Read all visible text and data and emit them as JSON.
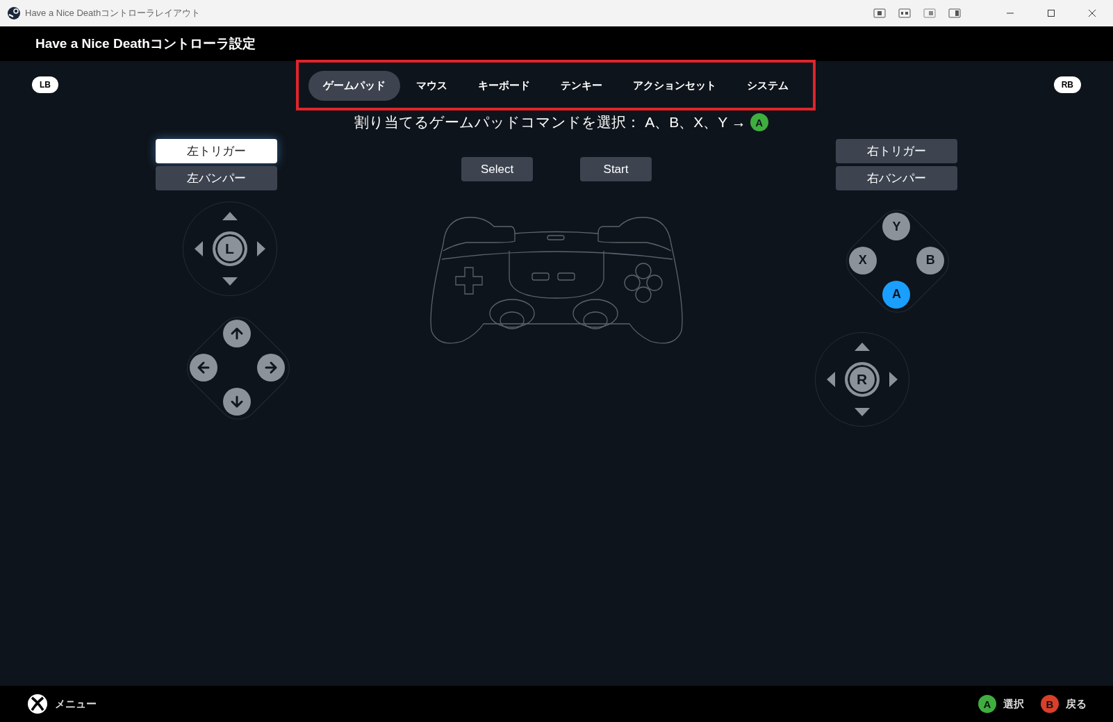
{
  "window": {
    "title": "Have a Nice Deathコントローラレイアウト"
  },
  "header": {
    "title": "Have a Nice Deathコントローラ設定"
  },
  "bumper_hints": {
    "left": "LB",
    "right": "RB"
  },
  "tabs": [
    {
      "label": "ゲームパッド",
      "selected": true
    },
    {
      "label": "マウス",
      "selected": false
    },
    {
      "label": "キーボード",
      "selected": false
    },
    {
      "label": "テンキー",
      "selected": false
    },
    {
      "label": "アクションセット",
      "selected": false
    },
    {
      "label": "システム",
      "selected": false
    }
  ],
  "prompt": {
    "text": "割り当てるゲームパッドコマンドを選択： A、B、X、Y →",
    "button": "A"
  },
  "left_controls": [
    {
      "label": "左トリガー",
      "selected": true
    },
    {
      "label": "左バンパー",
      "selected": false
    }
  ],
  "left_stick": {
    "label": "L"
  },
  "center_buttons": [
    "Select",
    "Start"
  ],
  "right_controls": [
    {
      "label": "右トリガー",
      "selected": false
    },
    {
      "label": "右バンパー",
      "selected": false
    }
  ],
  "face_buttons": [
    {
      "label": "Y",
      "selected": false
    },
    {
      "label": "X",
      "selected": false
    },
    {
      "label": "B",
      "selected": false
    },
    {
      "label": "A",
      "selected": true
    }
  ],
  "right_stick": {
    "label": "R"
  },
  "footer": {
    "menu": "メニュー",
    "actions": [
      {
        "button": "A",
        "label": "選択",
        "color": "#3fae3f"
      },
      {
        "button": "B",
        "label": "戻る",
        "color": "#d8402a"
      }
    ]
  }
}
